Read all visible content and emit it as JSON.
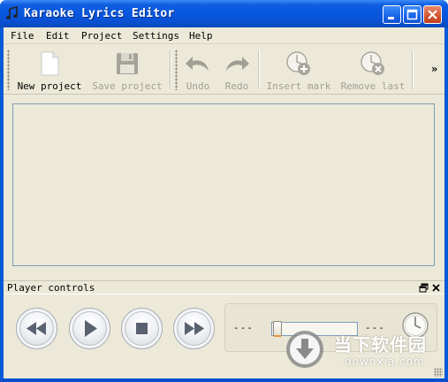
{
  "window": {
    "title": "Karaoke Lyrics Editor",
    "app_icon": "music-note-icon",
    "caption_buttons": [
      "minimize-icon",
      "maximize-icon",
      "close-icon"
    ]
  },
  "menu": {
    "items": [
      "File",
      "Edit",
      "Project",
      "Settings",
      "Help"
    ]
  },
  "toolbar": {
    "new_project": {
      "label": "New project",
      "icon": "document-icon",
      "enabled": true
    },
    "save_project": {
      "label": "Save project",
      "icon": "floppy-disk-icon",
      "enabled": false
    },
    "undo": {
      "label": "Undo",
      "icon": "undo-arrow-icon",
      "enabled": false
    },
    "redo": {
      "label": "Redo",
      "icon": "redo-arrow-icon",
      "enabled": false
    },
    "insert_mark": {
      "label": "Insert mark",
      "icon": "clock-plus-icon",
      "enabled": false
    },
    "remove_last": {
      "label": "Remove last",
      "icon": "clock-remove-icon",
      "enabled": false
    },
    "overflow": "»"
  },
  "player": {
    "title": "Player controls",
    "header_icons": [
      "float-window-icon",
      "close-icon"
    ],
    "controls": [
      "rewind-icon",
      "play-icon",
      "stop-icon",
      "fast-forward-icon"
    ],
    "time_left": "---",
    "time_right": "---",
    "position_fraction": 0.0,
    "clock_icon": "clock-icon"
  },
  "watermark": {
    "cn_text": "当下软件园",
    "en_text": "downxia.com",
    "icon": "download-arrow-icon"
  },
  "colors": {
    "titlebar": "#0a5ad8",
    "client_bg": "#ece9d8",
    "editor_border": "#7f9db9",
    "close_button": "#d2522e"
  }
}
